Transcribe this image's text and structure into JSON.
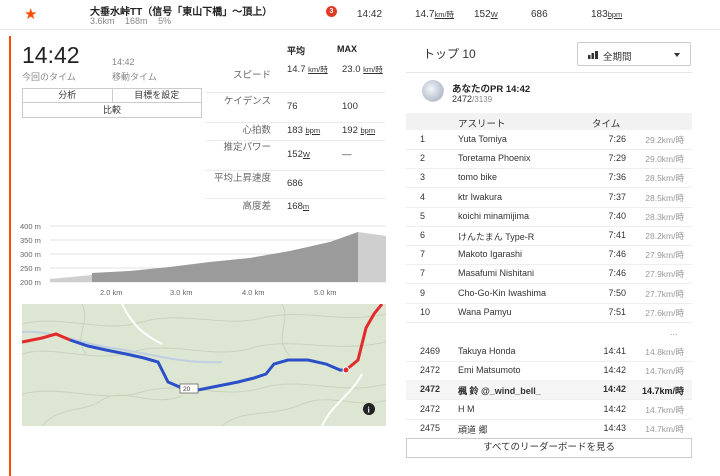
{
  "segment": {
    "name": "大垂水峠TT（信号「東山下橋」～頂上）",
    "distance": "3.6km",
    "elevation_gain": "168m",
    "grade": "5%",
    "rank_badge": "3",
    "time": "14:42",
    "speed_value": "14.7",
    "speed_unit": "km/時",
    "power_value": "152",
    "power_unit": "W",
    "heart_rate": "686",
    "cadence_value": "183",
    "cadence_unit": "bpm"
  },
  "summary": {
    "your_time": "14:42",
    "your_time_label": "今回のタイム",
    "moving_time": "14:42",
    "moving_time_label": "移動タイム",
    "buttons": {
      "analysis": "分析",
      "set_goal": "目標を設定",
      "compare": "比較"
    }
  },
  "stats": {
    "avg_header": "平均",
    "max_header": "MAX",
    "rows": [
      {
        "label": "スピード",
        "avg": "14.7",
        "avg_unit": "km/時",
        "max": "23.0",
        "max_unit": "km/時"
      },
      {
        "label": "ケイデンス",
        "avg": "76",
        "avg_unit": "",
        "max": "100",
        "max_unit": ""
      },
      {
        "label": "心拍数",
        "avg": "183",
        "avg_unit": "bpm",
        "max": "192",
        "max_unit": "bpm"
      },
      {
        "label": "推定パワー",
        "avg": "152",
        "avg_unit": "W",
        "max": "—",
        "max_unit": ""
      },
      {
        "label": "平均上昇速度",
        "avg": "686",
        "avg_unit": "",
        "max": "",
        "max_unit": ""
      },
      {
        "label": "高度差",
        "avg": "168",
        "avg_unit": "m",
        "max": "",
        "max_unit": ""
      }
    ]
  },
  "elevation_chart": {
    "y_ticks": [
      "400 m",
      "350 m",
      "300 m",
      "250 m",
      "200 m"
    ],
    "x_ticks": [
      "2.0 km",
      "3.0 km",
      "4.0 km",
      "5.0 km"
    ]
  },
  "map": {
    "info_icon": "i",
    "road_label": "20"
  },
  "leaderboard": {
    "title": "トップ 10",
    "period_label": "全期間",
    "pr_label": "あなたのPR 14:42",
    "pr_rank": "2472",
    "pr_total": "/3139",
    "header_athlete": "アスリート",
    "header_time": "タイム",
    "top": [
      {
        "rank": "1",
        "name": "Yuta Tomiya",
        "time": "7:26",
        "speed": "29.2km/時"
      },
      {
        "rank": "2",
        "name": "Toretama Phoenix",
        "time": "7:29",
        "speed": "29.0km/時"
      },
      {
        "rank": "3",
        "name": "tomo bike",
        "time": "7:36",
        "speed": "28.5km/時"
      },
      {
        "rank": "4",
        "name": "ktr Iwakura",
        "time": "7:37",
        "speed": "28.5km/時"
      },
      {
        "rank": "5",
        "name": "koichi minamijima",
        "time": "7:40",
        "speed": "28.3km/時"
      },
      {
        "rank": "6",
        "name": "けんたまん Type-R",
        "time": "7:41",
        "speed": "28.2km/時"
      },
      {
        "rank": "7",
        "name": "Makoto Igarashi",
        "time": "7:46",
        "speed": "27.9km/時"
      },
      {
        "rank": "7",
        "name": "Masafumi Nishitani",
        "time": "7:46",
        "speed": "27.9km/時"
      },
      {
        "rank": "9",
        "name": "Cho-Go-Kin Iwashima",
        "time": "7:50",
        "speed": "27.7km/時"
      },
      {
        "rank": "10",
        "name": "Wana Pamyu",
        "time": "7:51",
        "speed": "27.6km/時"
      }
    ],
    "ellipsis": "...",
    "nearby": [
      {
        "rank": "2469",
        "name": "Takuya Honda",
        "time": "14:41",
        "speed": "14.8km/時",
        "me": false
      },
      {
        "rank": "2472",
        "name": "Emi Matsumoto",
        "time": "14:42",
        "speed": "14.7km/時",
        "me": false
      },
      {
        "rank": "2472",
        "name": "楓 鈴 @_wind_bell_",
        "time": "14:42",
        "speed": "14.7km/時",
        "me": true
      },
      {
        "rank": "2472",
        "name": "H M",
        "time": "14:42",
        "speed": "14.7km/時",
        "me": false
      },
      {
        "rank": "2475",
        "name": "頑道 郷",
        "time": "14:43",
        "speed": "14.7km/時",
        "me": false
      }
    ],
    "view_all": "すべてのリーダーボードを見る"
  }
}
